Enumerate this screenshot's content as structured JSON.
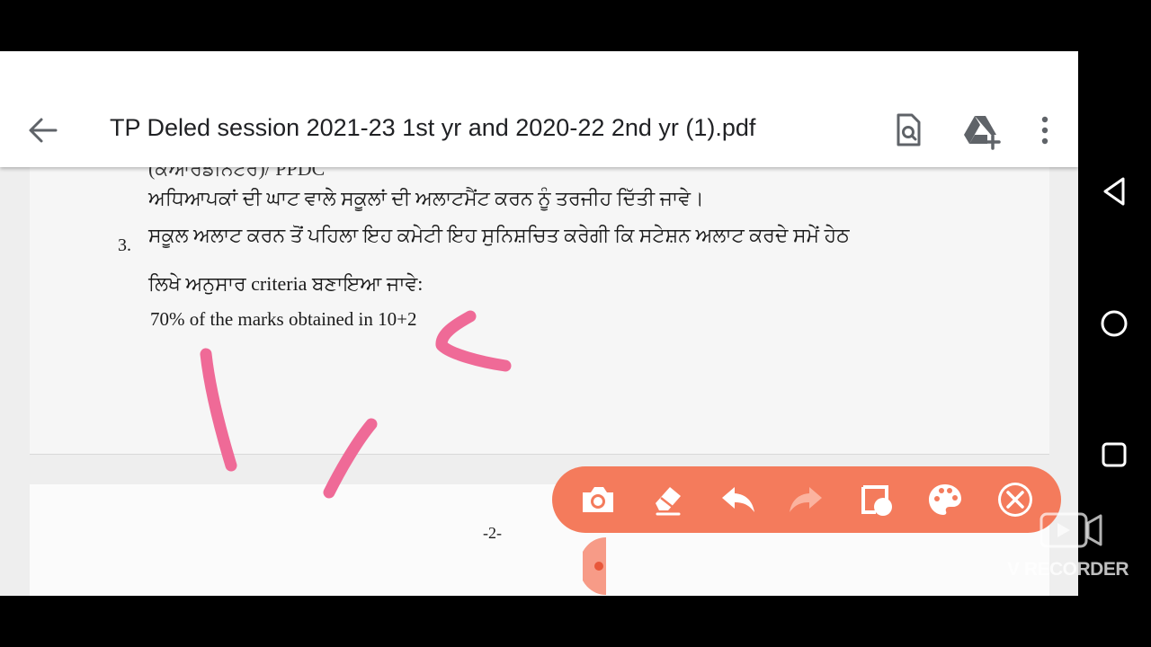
{
  "app": {
    "title": "TP Deled session 2021-23 1st yr and 2020-22 2nd yr (1).pdf",
    "icons": [
      "back-arrow-icon",
      "find-in-document-icon",
      "add-to-drive-icon",
      "more-vert-icon"
    ]
  },
  "document": {
    "page1": {
      "line_partial": "(ਕੋਆਰਡੀਨੇਟਰ)/ PPDC",
      "line1": "ਅਧਿਆਪਕਾਂ ਦੀ ਘਾਟ ਵਾਲੇ ਸਕੂਲਾਂ ਦੀ ਅਲਾਟਮੈਂਟ ਕਰਨ ਨੂੰ ਤਰਜੀਹ ਦਿੱਤੀ ਜਾਵੇ।",
      "item_number": "3.",
      "line2": "ਸਕੂਲ ਅਲਾਟ ਕਰਨ ਤੋਂ ਪਹਿਲਾ ਇਹ ਕਮੇਟੀ ਇਹ ਸੁਨਿਸ਼ਚਿਤ ਕਰੇਗੀ ਕਿ ਸਟੇਸ਼ਨ ਅਲਾਟ ਕਰਦੇ ਸਮੇਂ ਹੇਠ",
      "line3": "ਲਿਖੇ ਅਨੁਸਾਰ criteria ਬਣਾਇਆ ਜਾਵੇ:",
      "line4": "70% of the marks obtained in 10+2"
    },
    "page2": {
      "page_number": "-2-"
    }
  },
  "nav": {
    "icons": [
      "back-triangle-icon",
      "home-circle-icon",
      "recents-square-icon"
    ]
  },
  "recorder_toolbar": {
    "tools": [
      "camera-icon",
      "eraser-icon",
      "undo-icon",
      "redo-icon",
      "shape-icon",
      "palette-icon",
      "close-icon"
    ],
    "accent": "#f47b5c"
  },
  "watermark": {
    "label": "V RECORDER"
  },
  "annotation_color": "#ef6a97"
}
